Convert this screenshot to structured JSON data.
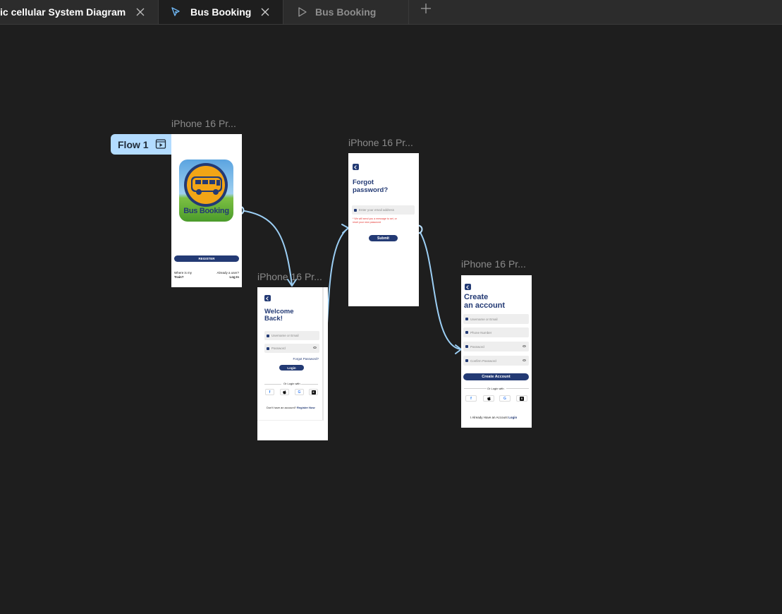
{
  "tabs": [
    {
      "title": "ic cellular System Diagram"
    },
    {
      "title": "Bus Booking"
    },
    {
      "title": "Bus Booking"
    }
  ],
  "flow": {
    "label": "Flow 1"
  },
  "frames": {
    "splash": {
      "label": "iPhone 16 Pr...",
      "logo_text": "Bus Booking",
      "register_label": "REGISTER",
      "left_link_1": "Where is my",
      "left_link_2": "Train?",
      "right_link_1": "Already a user?",
      "right_link_2": "Log In"
    },
    "login": {
      "label": "iPhone 16 Pr...",
      "title_1": "Welcome",
      "title_2": "Back!",
      "username_placeholder": "Username or Email",
      "password_placeholder": "Password",
      "forgot_link": "Forgot Password?",
      "login_label": "Login",
      "or_login": "Or Login with",
      "footer_text": "Don't have an account?",
      "footer_link": "Register Now"
    },
    "forgot": {
      "label": "iPhone 16 Pr...",
      "title_1": "Forgot",
      "title_2": "password?",
      "email_placeholder": "Enter your email address",
      "note_1": "* We will send you a message to set, or",
      "note_2": "reset your new password",
      "submit_label": "Submit"
    },
    "create": {
      "label": "iPhone 16 Pr...",
      "title_1": "Create",
      "title_2": "an account",
      "username_placeholder": "Username or Email",
      "phone_placeholder": "Phone Number",
      "password_placeholder": "Password",
      "confirm_placeholder": "Confirm Password",
      "create_label": "Create Account",
      "or_login": "Or Login with",
      "footer_text": "I Already Have an Account",
      "footer_link": "Login"
    }
  },
  "social": {
    "facebook": "f",
    "google": "G",
    "x": "X"
  },
  "colors": {
    "canvas": "#1e1e1e",
    "tabbar": "#2c2c2c",
    "navy": "#233a74",
    "connector": "#9ccff5",
    "flow_badge": "#b3dcff"
  }
}
